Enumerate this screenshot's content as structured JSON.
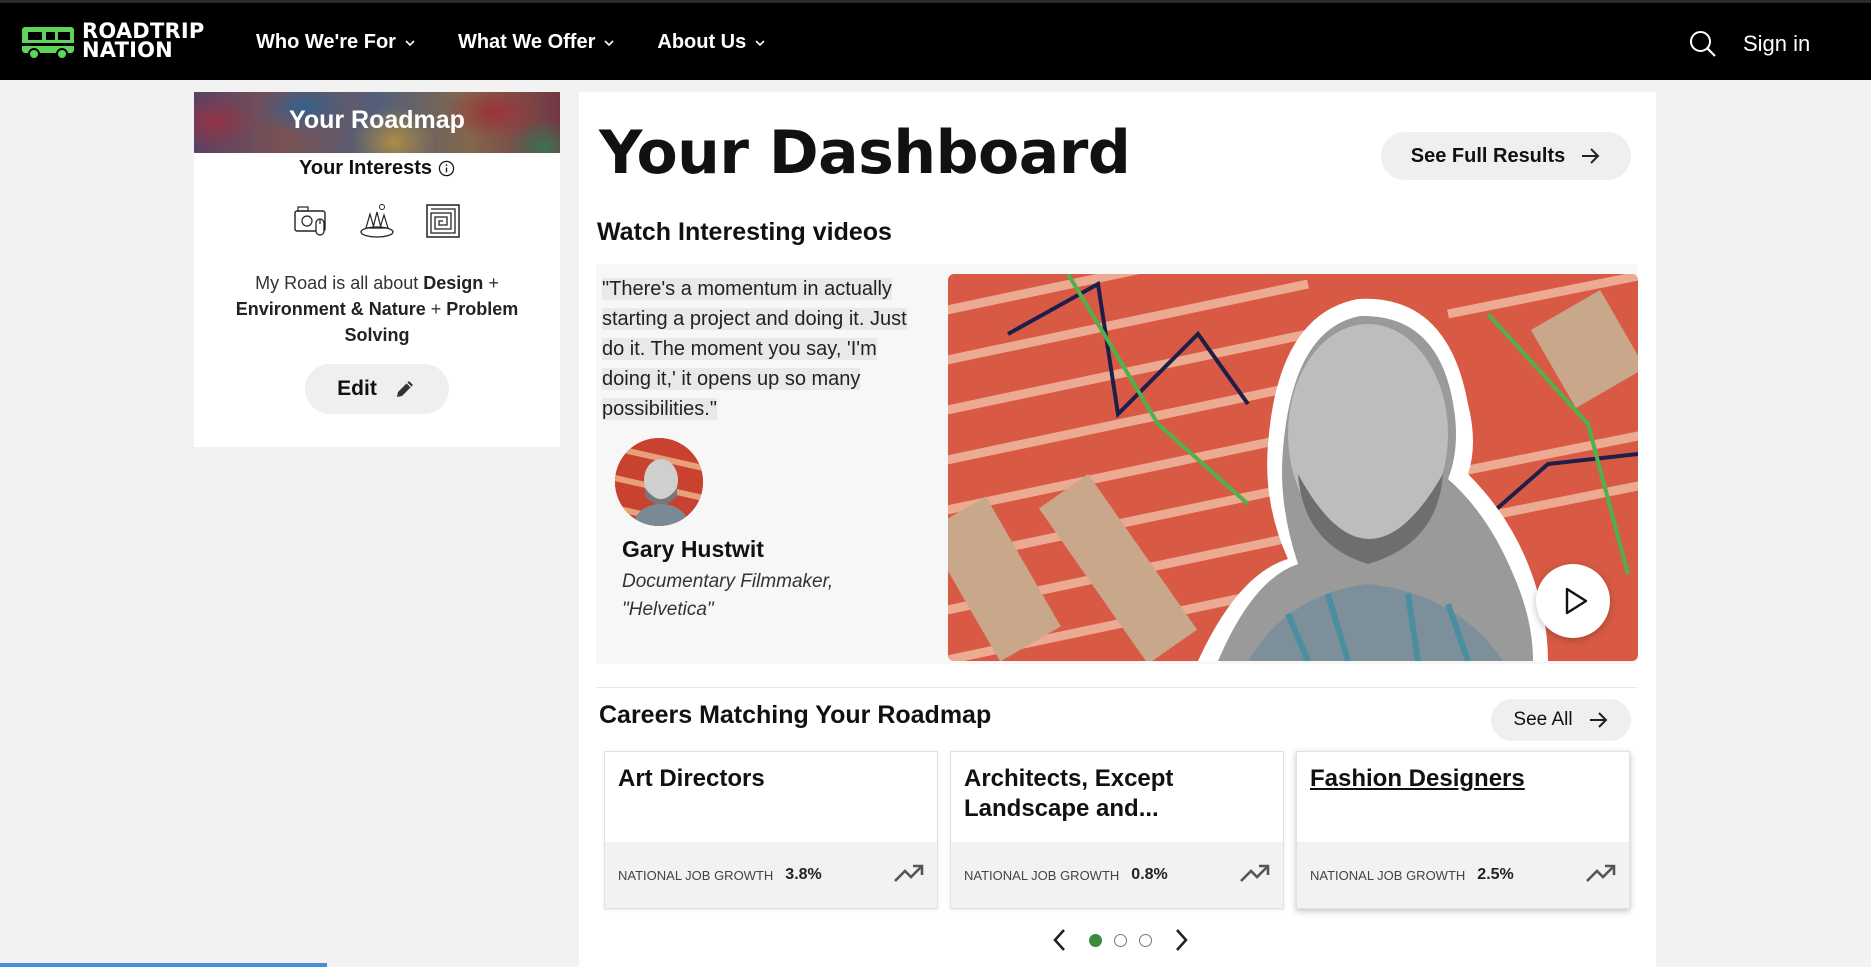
{
  "header": {
    "logo_line1": "ROADTRIP",
    "logo_line2": "NATION",
    "nav": [
      {
        "label": "Who We're For"
      },
      {
        "label": "What We Offer"
      },
      {
        "label": "About Us"
      }
    ],
    "signin_label": "Sign in"
  },
  "roadmap": {
    "title": "Your Roadmap",
    "interests_heading": "Your Interests",
    "interest_icons": [
      "design-icon",
      "environment-nature-icon",
      "problem-solving-icon"
    ],
    "road_prefix": "My Road is all about",
    "interest_1": "Design",
    "interest_2": "Environment & Nature",
    "interest_3": "Problem Solving",
    "plus": "+",
    "edit_label": "Edit"
  },
  "dashboard": {
    "title": "Your Dashboard",
    "full_results_label": "See Full Results",
    "videos_heading": "Watch Interesting videos",
    "video": {
      "quote": "\"There's a momentum in actually starting a project and doing it. Just do it. The moment you say, 'I'm doing it,' it opens up so many possibilities.\"",
      "speaker_name": "Gary Hustwit",
      "speaker_role": "Documentary Filmmaker, \"Helvetica\""
    },
    "careers_heading": "Careers Matching Your Roadmap",
    "see_all_label": "See All",
    "careers": [
      {
        "title": "Art Directors",
        "growth_label": "NATIONAL JOB GROWTH",
        "growth": "3.8%"
      },
      {
        "title": "Architects, Except Landscape and...",
        "growth_label": "NATIONAL JOB GROWTH",
        "growth": "0.8%"
      },
      {
        "title": "Fashion Designers",
        "growth_label": "NATIONAL JOB GROWTH",
        "growth": "2.5%"
      }
    ],
    "pager": {
      "pages": 3,
      "current": 1
    }
  },
  "colors": {
    "brand_green": "#5fd35a",
    "active_dot": "#3c8a3c",
    "header_bg": "#000000"
  }
}
